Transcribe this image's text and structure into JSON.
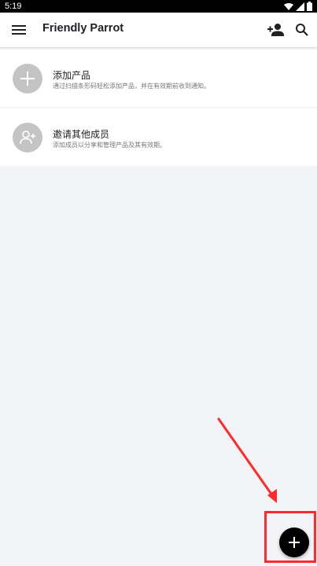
{
  "status_bar": {
    "time": "5:19"
  },
  "app_bar": {
    "title": "Friendly Parrot"
  },
  "cards": [
    {
      "title": "添加产品",
      "description": "通过扫描条形码轻松添加产品，并在有效期前收到通知。",
      "icon": "plus-icon"
    },
    {
      "title": "邀请其他成员",
      "description": "添加成员以分享和管理产品及其有效期。",
      "icon": "add-person-icon"
    }
  ],
  "fab": {
    "icon": "plus-icon"
  },
  "colors": {
    "accent": "#000000",
    "highlight": "#ff2a2a",
    "avatar_bg": "#c4c4c4",
    "background": "#f3f4f7"
  }
}
